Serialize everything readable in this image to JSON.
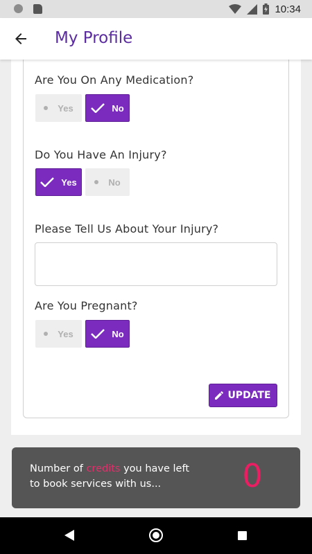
{
  "status_bar": {
    "time": "10:34"
  },
  "app_bar": {
    "title": "My Profile"
  },
  "questions": {
    "medication": {
      "label": "Are You On Any Medication?",
      "yes": "Yes",
      "no": "No",
      "selected": "No"
    },
    "injury": {
      "label": "Do You Have An Injury?",
      "yes": "Yes",
      "no": "No",
      "selected": "Yes"
    },
    "injury_details": {
      "label": "Please Tell Us About Your Injury?",
      "value": ""
    },
    "pregnant": {
      "label": "Are You Pregnant?",
      "yes": "Yes",
      "no": "No",
      "selected": "No"
    }
  },
  "update_button": {
    "label": "UPDATE"
  },
  "credits": {
    "text_before": "Number of ",
    "highlight": "credits",
    "text_after": " you have left to book services with us...",
    "count": "0"
  },
  "colors": {
    "accent": "#7b2cbf",
    "title": "#5b2ca0",
    "credit_count": "#e91e63",
    "credits_bg": "#555555"
  }
}
